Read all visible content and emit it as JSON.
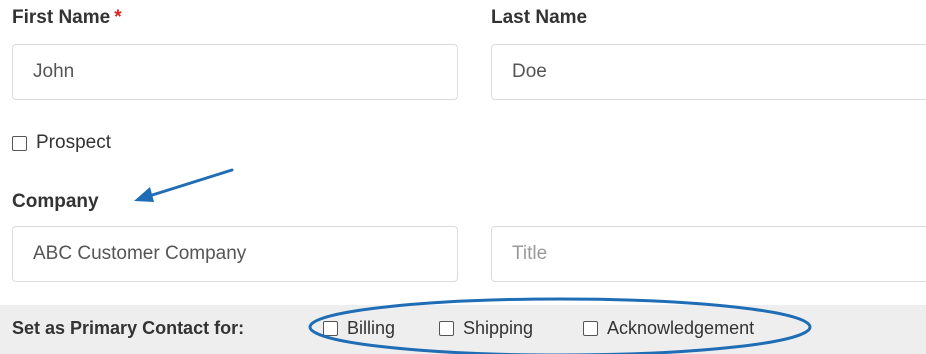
{
  "form": {
    "first_name": {
      "label": "First Name",
      "required_mark": "*",
      "value": "John",
      "placeholder": ""
    },
    "last_name": {
      "label": "Last Name",
      "value": "Doe",
      "placeholder": ""
    },
    "prospect": {
      "label": "Prospect",
      "checked": false
    },
    "company": {
      "label": "Company",
      "value": "ABC Customer Company",
      "placeholder": ""
    },
    "title": {
      "value": "",
      "placeholder": "Title"
    },
    "primary_contact": {
      "label": "Set as Primary Contact for:",
      "options": [
        {
          "label": "Billing",
          "checked": false
        },
        {
          "label": "Shipping",
          "checked": false
        },
        {
          "label": "Acknowledgement",
          "checked": false
        }
      ]
    }
  },
  "annotation_color": "#1f6db5",
  "icons": {
    "arrow": "annotation-arrow-icon",
    "ellipse": "annotation-ellipse-icon"
  }
}
